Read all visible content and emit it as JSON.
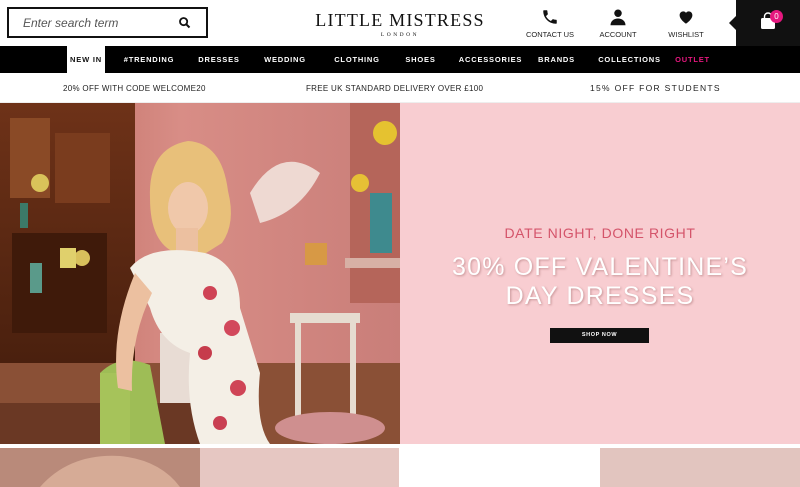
{
  "search": {
    "placeholder": "Enter search term",
    "icon": "search-icon"
  },
  "logo": {
    "brand": "LITTLE MISTRESS",
    "sub": "LONDON"
  },
  "header_links": {
    "contact": "CONTACT US",
    "account": "ACCOUNT",
    "wishlist": "WISHLIST"
  },
  "cart": {
    "count": "0"
  },
  "nav": {
    "items": [
      "NEW IN",
      "#TRENDING",
      "DRESSES",
      "WEDDING",
      "CLOTHING",
      "SHOES",
      "ACCESSORIES",
      "BRANDS",
      "COLLECTIONS",
      "OUTLET"
    ],
    "active": "NEW IN",
    "outlet_color": "#e5177e"
  },
  "promo": {
    "code": "20% OFF WITH CODE WELCOME20",
    "delivery": "FREE UK STANDARD DELIVERY OVER £100",
    "students": "15% OFF FOR STUDENTS"
  },
  "hero": {
    "kicker": "DATE NIGHT, DONE RIGHT",
    "headline_line1": "30% OFF VALENTINE’S",
    "headline_line2": "DAY DRESSES",
    "cta": "SHOP NOW",
    "background": "#f8cdd1"
  }
}
